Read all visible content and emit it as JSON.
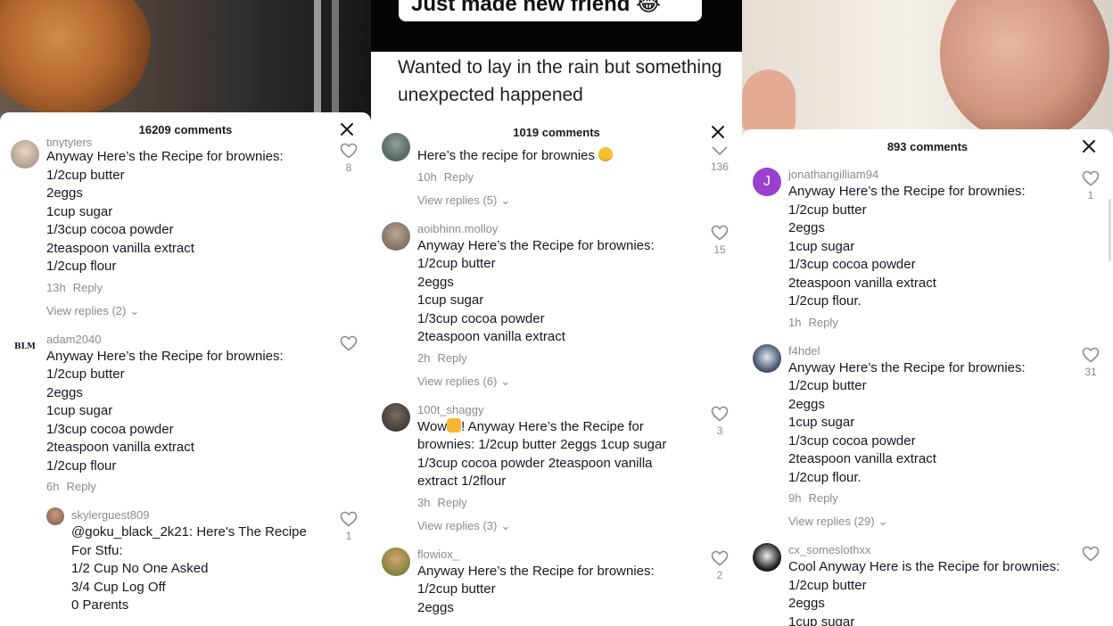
{
  "panels": [
    {
      "comment_count": "16209 comments",
      "comments": [
        {
          "username": "tinytylers",
          "text": "Anyway Here’s the Recipe for brownies:\n1/2cup butter\n2eggs\n1cup sugar\n1/3cup cocoa powder\n2teaspoon vanilla extract\n1/2cup flour",
          "time": "13h",
          "reply_label": "Reply",
          "likes": "8",
          "view_replies": "View replies (2)"
        },
        {
          "username": "adam2040",
          "text": "Anyway Here’s the Recipe for brownies:\n1/2cup butter\n2eggs\n1cup sugar\n1/3cup cocoa powder\n2teaspoon vanilla extract\n1/2cup flour",
          "time": "6h",
          "reply_label": "Reply",
          "likes": ""
        },
        {
          "username": "skylerguest809",
          "text": "@goku_black_2k21:  Here's The Recipe For Stfu:\n1/2 Cup No One Asked\n3/4 Cup Log Off\n0 Parents",
          "likes": "1",
          "is_reply": true
        }
      ]
    },
    {
      "video_caption_top": "Just made new friend 😂",
      "video_caption": "Wanted to lay in the rain but something unexpected happened",
      "comment_count": "1019 comments",
      "comments": [
        {
          "username": "",
          "text": "Here’s the recipe for brownies",
          "emoji": "nerd",
          "time": "10h",
          "reply_label": "Reply",
          "likes": "136",
          "view_replies": "View replies (5)"
        },
        {
          "username": "aoibhinn.molloy",
          "text": "Anyway Here’s the Recipe for brownies:\n1/2cup butter\n2eggs\n1cup sugar\n1/3cup cocoa powder\n2teaspoon vanilla extract",
          "time": "2h",
          "reply_label": "Reply",
          "likes": "15",
          "view_replies": "View replies (6)"
        },
        {
          "username": "100t_shaggy",
          "text": "! Anyway Here’s the Recipe for brownies: 1/2cup butter 2eggs 1cup sugar 1/3cup cocoa powder 2teaspoon vanilla extract 1/2flour",
          "text_prefix": "Wow",
          "emoji": "thumb",
          "time": "3h",
          "reply_label": "Reply",
          "likes": "3",
          "view_replies": "View replies (3)"
        },
        {
          "username": "flowiox_",
          "text": "Anyway Here’s the Recipe for brownies:\n1/2cup butter\n2eggs",
          "likes": "2"
        }
      ]
    },
    {
      "comment_count": "893 comments",
      "comments": [
        {
          "username": "jonathangilliam94",
          "avatar_letter": "J",
          "text": "Anyway Here’s the Recipe for brownies:\n1/2cup butter\n2eggs\n1cup sugar\n1/3cup cocoa powder\n2teaspoon vanilla extract\n1/2cup flour.",
          "time": "1h",
          "reply_label": "Reply",
          "likes": "1"
        },
        {
          "username": "f4hdel",
          "text": "Anyway Here’s the Recipe for brownies:\n1/2cup butter\n2eggs\n1cup sugar\n1/3cup cocoa powder\n2teaspoon vanilla extract\n1/2cup flour.",
          "time": "9h",
          "reply_label": "Reply",
          "likes": "31",
          "view_replies": "View replies (29)"
        },
        {
          "username": "cx_someslothxx",
          "text": "Cool Anyway Here is the Recipe for brownies:\n1/2cup butter\n2eggs\n1cup sugar",
          "likes": ""
        }
      ]
    }
  ],
  "colors": {
    "muted": "#8a8b91",
    "text": "#161823",
    "avatar_purple": "#9b3fd0"
  }
}
